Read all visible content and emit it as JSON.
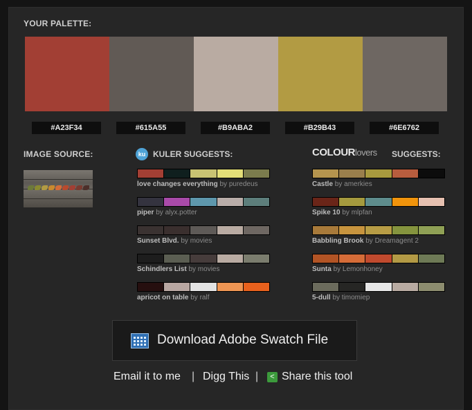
{
  "palette": {
    "title": "YOUR PALETTE:",
    "colors": [
      {
        "hex": "#A23F34"
      },
      {
        "hex": "#615A55"
      },
      {
        "hex": "#B9ABA2"
      },
      {
        "hex": "#B29B43"
      },
      {
        "hex": "#6E6762"
      }
    ]
  },
  "image_source": {
    "title": "IMAGE SOURCE:"
  },
  "kuler": {
    "logo_text": "ku",
    "title": "KULER SUGGESTS:",
    "items": [
      {
        "name": "love changes everything",
        "by": "by puredeus",
        "colors": [
          "#a23f34",
          "#0f1f1e",
          "#c9c373",
          "#e3de78",
          "#7b7c4d"
        ]
      },
      {
        "name": "piper",
        "by": "by alyx.potter",
        "colors": [
          "#34333f",
          "#a94aa9",
          "#5e97ac",
          "#b9ada9",
          "#5d7e7b"
        ]
      },
      {
        "name": "Sunset Blvd.",
        "by": "by movies",
        "colors": [
          "#3a3231",
          "#3a2f2e",
          "#5e5a57",
          "#b9aba2",
          "#6e6762"
        ]
      },
      {
        "name": "Schindlers List",
        "by": "by movies",
        "colors": [
          "#1d1d1d",
          "#5b5e52",
          "#463c3b",
          "#b9aba2",
          "#7b7d6e"
        ]
      },
      {
        "name": "apricot on table",
        "by": "by ralf",
        "colors": [
          "#260f0f",
          "#b9a7a2",
          "#e3e3e3",
          "#ee9553",
          "#e8611d"
        ]
      }
    ]
  },
  "colourlovers": {
    "logo_main": "COLOUR",
    "logo_sub": "lovers",
    "title": "SUGGESTS:",
    "items": [
      {
        "name": "Castle",
        "by": "by amerkies",
        "colors": [
          "#b4944e",
          "#9a7f4c",
          "#a89a3e",
          "#b85d3e",
          "#0c0c0c"
        ]
      },
      {
        "name": "Spike 10",
        "by": "by mlpfan",
        "colors": [
          "#6a2518",
          "#a59a3e",
          "#5e8c8c",
          "#f1940c",
          "#e6c0b0"
        ]
      },
      {
        "name": "Babbling Brook",
        "by": "by Dreamagent 2",
        "colors": [
          "#a87a3a",
          "#c7943e",
          "#b79c45",
          "#85943e",
          "#8fa055"
        ]
      },
      {
        "name": "Sunta",
        "by": "by Lemonhoney",
        "colors": [
          "#b25425",
          "#d56c38",
          "#c04a2e",
          "#b39a45",
          "#6e7a56"
        ]
      },
      {
        "name": "5-dull",
        "by": "by timomiep",
        "colors": [
          "#6b6b5c",
          "#262624",
          "#e6e6e6",
          "#b9aba2",
          "#8c8c6e"
        ]
      }
    ]
  },
  "download": {
    "label": "Download Adobe Swatch File"
  },
  "links": {
    "email": "Email it to me",
    "sep": "|",
    "digg": "Digg This",
    "share": "Share this tool"
  }
}
